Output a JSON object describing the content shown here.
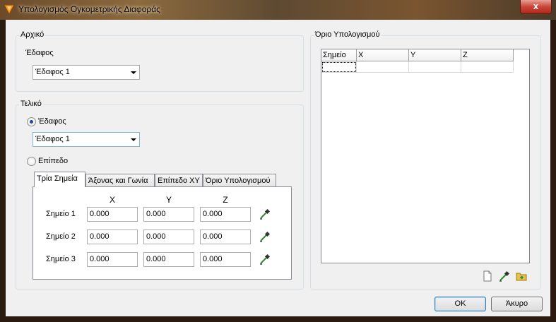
{
  "window": {
    "title": "Υπολογισμός Ογκομετρικής Διαφοράς",
    "close_glyph": "x"
  },
  "initial": {
    "group_label": "Αρχικό",
    "surface_label": "Έδαφος",
    "surface_value": "Έδαφος 1"
  },
  "final": {
    "group_label": "Τελικό",
    "surface_option": "Έδαφος",
    "surface_value": "Έδαφος 1",
    "plane_option": "Επίπεδο",
    "selected_option": "surface",
    "tabs": [
      {
        "label": "Τρία Σημεία",
        "active": true
      },
      {
        "label": "Άξονας και Γωνία",
        "active": false
      },
      {
        "label": "Επίπεδο XY",
        "active": false
      },
      {
        "label": "Όριο Υπολογισμού",
        "active": false
      }
    ],
    "col_x": "X",
    "col_y": "Y",
    "col_z": "Z",
    "points": [
      {
        "label": "Σημείο 1",
        "x": "0.000",
        "y": "0.000",
        "z": "0.000"
      },
      {
        "label": "Σημείο 2",
        "x": "0.000",
        "y": "0.000",
        "z": "0.000"
      },
      {
        "label": "Σημείο 3",
        "x": "0.000",
        "y": "0.000",
        "z": "0.000"
      }
    ]
  },
  "boundary": {
    "group_label": "Όριο Υπολογισμού",
    "columns": [
      "Σημείο",
      "X",
      "Y",
      "Z"
    ]
  },
  "buttons": {
    "ok": "OK",
    "cancel": "Άκυρο"
  },
  "icons": {
    "app": "volume-triangle-icon",
    "picker": "eyedropper-icon",
    "new": "new-document-icon",
    "open": "open-folder-icon"
  },
  "colors": {
    "accent": "#3c7fb1",
    "close": "#c7473a",
    "picker_green": "#2e8b2e"
  }
}
